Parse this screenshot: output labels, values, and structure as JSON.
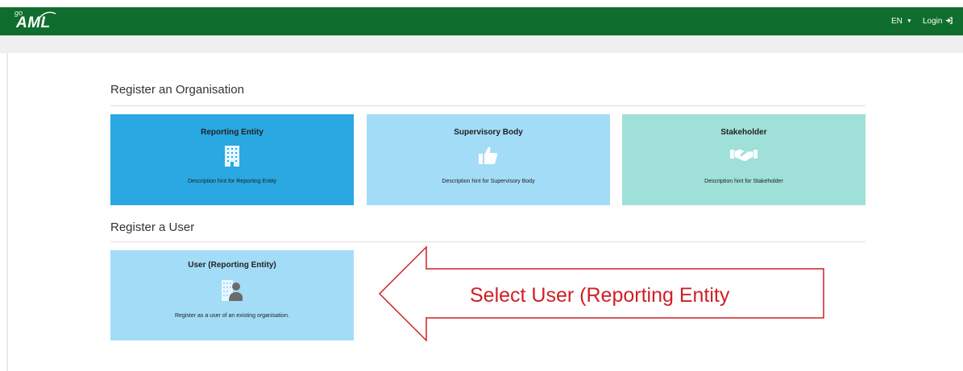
{
  "header": {
    "logo_go": "go",
    "logo_aml": "AML",
    "language": "EN",
    "login_label": "Login"
  },
  "org_section": {
    "title": "Register an Organisation",
    "cards": [
      {
        "title": "Reporting Entity",
        "description": "Description hint for Reporting Entity",
        "icon": "building-icon",
        "color": "#29a8e1"
      },
      {
        "title": "Supervisory Body",
        "description": "Description hint for Supervisory Body",
        "icon": "thumbs-up-icon",
        "color": "#a3dcf7"
      },
      {
        "title": "Stakeholder",
        "description": "Description hint for Stakeholder",
        "icon": "handshake-icon",
        "color": "#9fe0d8"
      }
    ]
  },
  "user_section": {
    "title": "Register a User",
    "cards": [
      {
        "title": "User (Reporting Entity)",
        "description": "Register as a user of an existing organisation.",
        "icon": "user-building-icon",
        "color": "#a3dcf7"
      }
    ]
  },
  "callout": {
    "text": "Select User (Reporting Entity",
    "color": "#d01f26"
  }
}
